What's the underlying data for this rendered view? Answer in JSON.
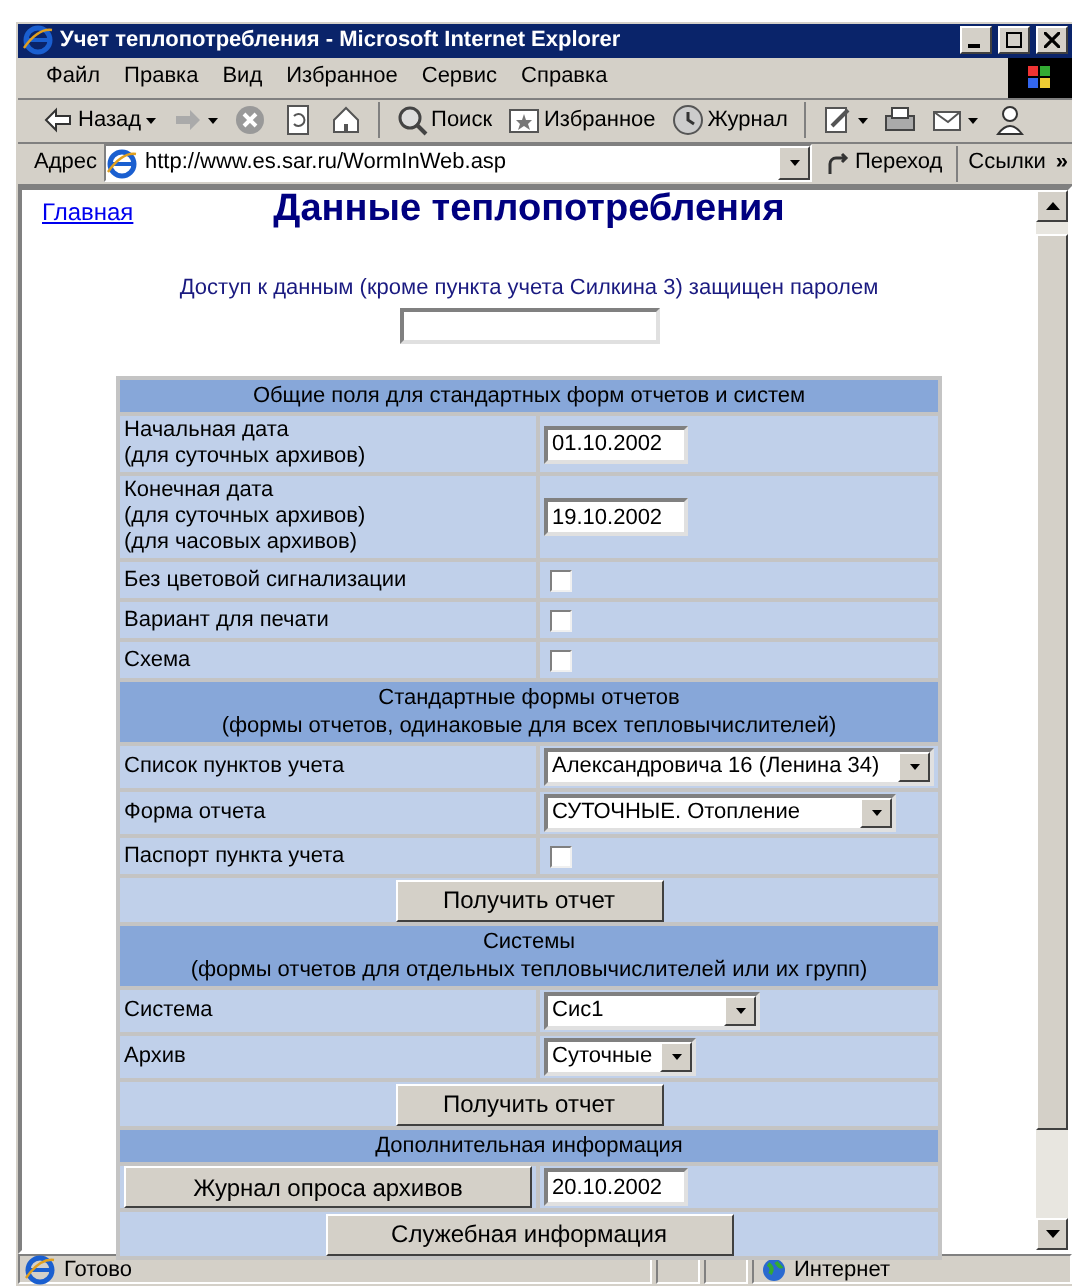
{
  "window": {
    "title": "Учет теплопотребления - Microsoft Internet Explorer"
  },
  "menu": [
    "Файл",
    "Правка",
    "Вид",
    "Избранное",
    "Сервис",
    "Справка"
  ],
  "toolbar": [
    {
      "kind": "back",
      "label": "Назад"
    },
    {
      "kind": "forward"
    },
    {
      "kind": "stop"
    },
    {
      "kind": "refresh"
    },
    {
      "kind": "home"
    },
    {
      "kind": "search",
      "label": "Поиск"
    },
    {
      "kind": "favorites",
      "label": "Избранное"
    },
    {
      "kind": "history",
      "label": "Журнал"
    },
    {
      "kind": "edit"
    },
    {
      "kind": "print"
    },
    {
      "kind": "mail"
    },
    {
      "kind": "user"
    }
  ],
  "address": {
    "label": "Адрес",
    "url": "http://www.es.sar.ru/WormInWeb.asp",
    "go": "Переход",
    "links": "Ссылки",
    "more": "»"
  },
  "page": {
    "home_link": "Главная",
    "heading": "Данные теплопотребления",
    "notice": "Доступ к данным (кроме пункта учета Силкина 3) защищен паролем",
    "rows": [
      {
        "kind": "header",
        "lines": [
          "Общие поля для стандартных форм отчетов и систем"
        ]
      },
      {
        "kind": "date",
        "lines": [
          "Начальная дата",
          "(для суточных архивов)"
        ],
        "value": "01.10.2002"
      },
      {
        "kind": "date",
        "lines": [
          "Конечная дата",
          "(для суточных архивов)",
          "(для часовых архивов)"
        ],
        "value": "19.10.2002"
      },
      {
        "kind": "checkbox",
        "label": "Без цветовой сигнализации",
        "checked": false
      },
      {
        "kind": "checkbox",
        "label": "Вариант для печати",
        "checked": false
      },
      {
        "kind": "checkbox",
        "label": "Схема",
        "checked": false
      },
      {
        "kind": "header",
        "lines": [
          "Стандартные формы отчетов",
          "(формы отчетов, одинаковые для всех тепловычислителей)"
        ]
      },
      {
        "kind": "select",
        "label": "Список пунктов учета",
        "value": "Александровича 16 (Ленина 34)"
      },
      {
        "kind": "select",
        "label": "Форма отчета",
        "value": "СУТОЧНЫЕ. Отопление"
      },
      {
        "kind": "checkbox",
        "label": "Паспорт пункта учета",
        "checked": false
      },
      {
        "kind": "button",
        "label": "Получить отчет"
      },
      {
        "kind": "header",
        "lines": [
          "Системы",
          "(формы отчетов для отдельных тепловычислителей или их групп)"
        ]
      },
      {
        "kind": "select",
        "label": "Система",
        "value": "Сис1"
      },
      {
        "kind": "select",
        "label": "Архив",
        "value": "Суточные"
      },
      {
        "kind": "button",
        "label": "Получить отчет"
      },
      {
        "kind": "header",
        "lines": [
          "Дополнительная информация"
        ]
      },
      {
        "kind": "button_date",
        "label": "Журнал опроса архивов",
        "value": "20.10.2002"
      },
      {
        "kind": "button",
        "label": "Служебная информация"
      }
    ]
  },
  "status_bar": {
    "text": "Готово",
    "zone": "Интернет"
  }
}
